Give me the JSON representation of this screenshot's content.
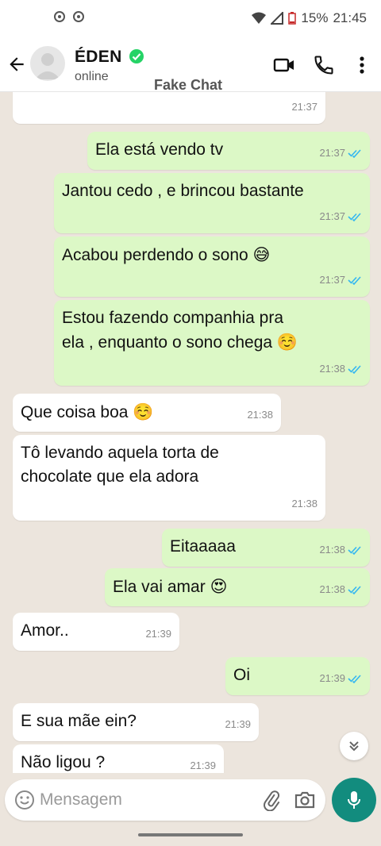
{
  "status_bar": {
    "battery": "15%",
    "time": "21:45"
  },
  "header": {
    "contact_name": "ÉDEN",
    "contact_status": "online",
    "app_name": "Fake Chat"
  },
  "messages": [
    {
      "direction": "in",
      "text": "",
      "time": "21:37"
    },
    {
      "direction": "out",
      "text": "Ela está vendo tv",
      "time": "21:37"
    },
    {
      "direction": "out",
      "text": "Jantou cedo , e brincou bastante",
      "time": "21:37"
    },
    {
      "direction": "out",
      "text": "Acabou perdendo o sono",
      "emoji": "😅",
      "time": "21:37"
    },
    {
      "direction": "out",
      "text": "Estou fazendo companhia pra\nela , enquanto o sono chega",
      "emoji": "☺️",
      "time": "21:38"
    },
    {
      "direction": "in",
      "text": "Que coisa boa",
      "emoji": "☺️",
      "time": "21:38"
    },
    {
      "direction": "in",
      "text": "Tô levando aquela torta de\nchocolate que ela adora",
      "time": "21:38"
    },
    {
      "direction": "out",
      "text": "Eitaaaaa",
      "time": "21:38"
    },
    {
      "direction": "out",
      "text": "Ela vai amar",
      "emoji": "😍",
      "time": "21:38"
    },
    {
      "direction": "in",
      "text": "Amor..",
      "time": "21:39"
    },
    {
      "direction": "out",
      "text": "Oi",
      "time": "21:39"
    },
    {
      "direction": "in",
      "text": "E sua mãe ein?",
      "time": "21:39"
    },
    {
      "direction": "in",
      "text": "Não ligou ?",
      "time": "21:39"
    }
  ],
  "input": {
    "placeholder": "Mensagem"
  },
  "colors": {
    "outgoing_bubble": "#dcf8c6",
    "incoming_bubble": "#ffffff",
    "accent": "#128c7e",
    "read_ticks": "#34b7f1",
    "verified": "#25d366"
  }
}
